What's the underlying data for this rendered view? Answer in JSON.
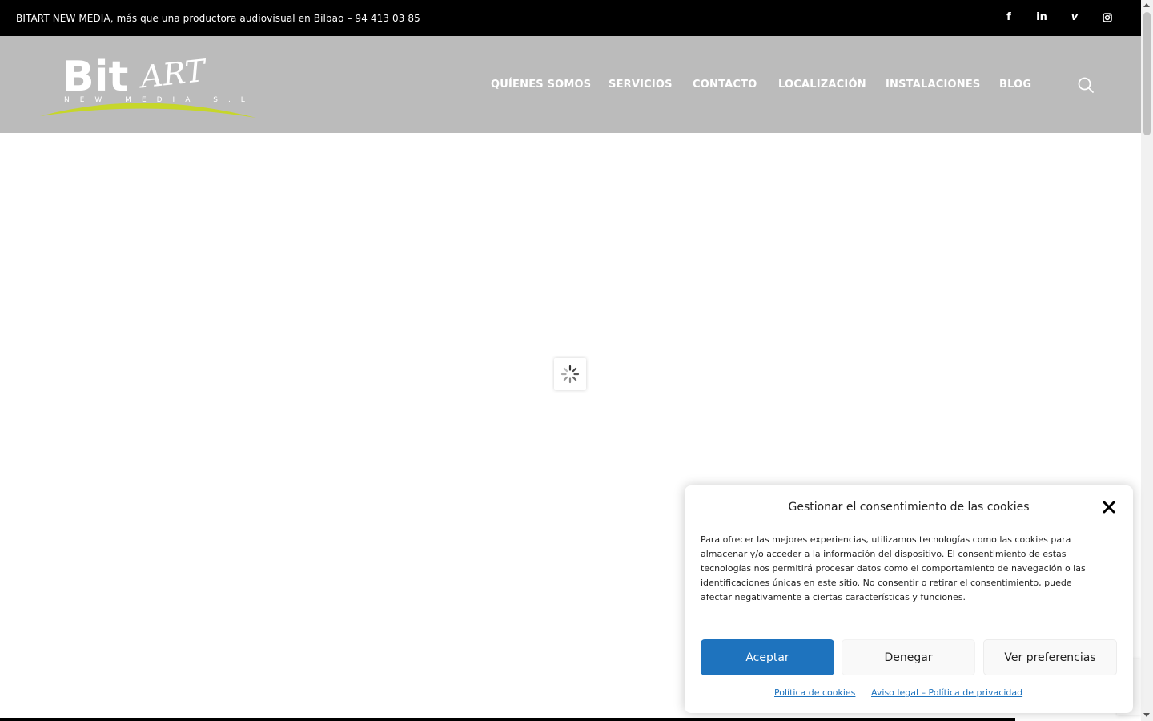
{
  "topbar": {
    "text": "BITART NEW MEDIA,  más que una productora audiovisual en Bilbao – 94 413 03 85",
    "social": {
      "facebook": "f",
      "linkedin": "in",
      "vimeo": "v",
      "instagram": "instagram-icon"
    }
  },
  "header": {
    "logo": {
      "main": "Bit",
      "script": "ART",
      "sub": "NEW MEDIA S.L",
      "accent_color": "#c6d62a"
    },
    "nav": [
      {
        "label": "QUÍENES SOMOS"
      },
      {
        "label": "SERVICIOS"
      },
      {
        "label": "CONTACTO"
      },
      {
        "label": "LOCALIZACIÓN"
      },
      {
        "label": "INSTALACIONES"
      },
      {
        "label": "BLOG"
      }
    ],
    "search_icon": "search-icon",
    "background": "#bbbbbb"
  },
  "content": {
    "loading_icon": "spinner-icon"
  },
  "cookie": {
    "title": "Gestionar el consentimiento de las cookies",
    "body": "Para ofrecer las mejores experiencias, utilizamos tecnologías como las cookies para almacenar y/o acceder a la información del dispositivo. El consentimiento de estas tecnologías nos permitirá procesar datos como el comportamiento de navegación o las identificaciones únicas en este sitio. No consentir o retirar el consentimiento, puede afectar negativamente a ciertas características y funciones.",
    "accept_label": "Aceptar",
    "deny_label": "Denegar",
    "prefs_label": "Ver preferencias",
    "links": [
      "Política de cookies",
      "Aviso legal – Política de privacidad"
    ],
    "accent_color": "#1e73be"
  }
}
